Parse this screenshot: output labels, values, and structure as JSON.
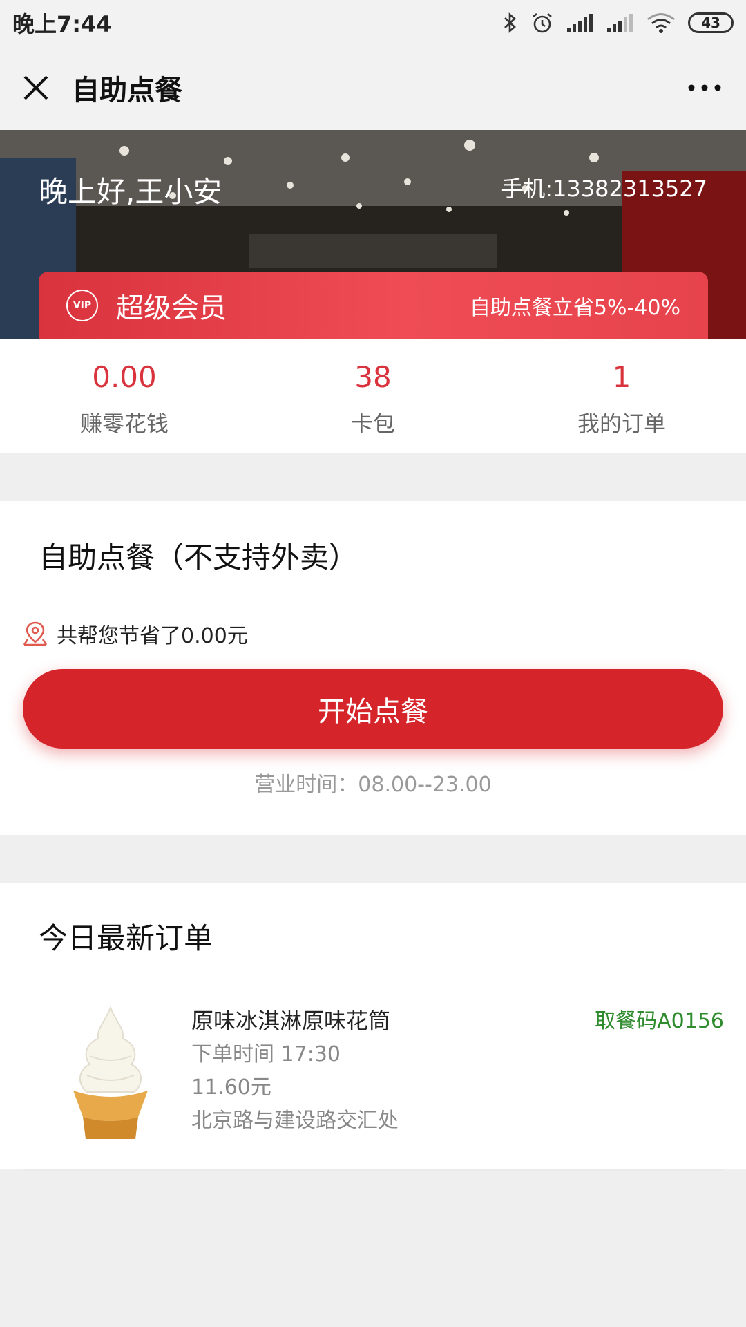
{
  "status_bar": {
    "time": "晚上7:44",
    "battery": "43"
  },
  "title_bar": {
    "title": "自助点餐"
  },
  "header": {
    "greeting": "晚上好,王小安",
    "phone": "手机:13382313527",
    "vip_badge": "VIP",
    "vip_title": "超级会员",
    "vip_promo": "自助点餐立省5%-40%"
  },
  "stats": [
    {
      "value": "0.00",
      "label": "赚零花钱"
    },
    {
      "value": "38",
      "label": "卡包"
    },
    {
      "value": "1",
      "label": "我的订单"
    }
  ],
  "self_order": {
    "title": "自助点餐（不支持外卖）",
    "savings": "共帮您节省了0.00元",
    "start_button": "开始点餐",
    "hours": "营业时间：08.00--23.00"
  },
  "today_orders": {
    "title": "今日最新订单",
    "items": [
      {
        "name": "原味冰淇淋原味花筒",
        "time": "下单时间 17:30",
        "price": "11.60元",
        "address": "北京路与建设路交汇处",
        "pickup_code": "取餐码A0156"
      }
    ]
  },
  "colors": {
    "accent": "#d6242b",
    "stat_red": "#d9333d",
    "pickup_green": "#2e8b2e"
  }
}
